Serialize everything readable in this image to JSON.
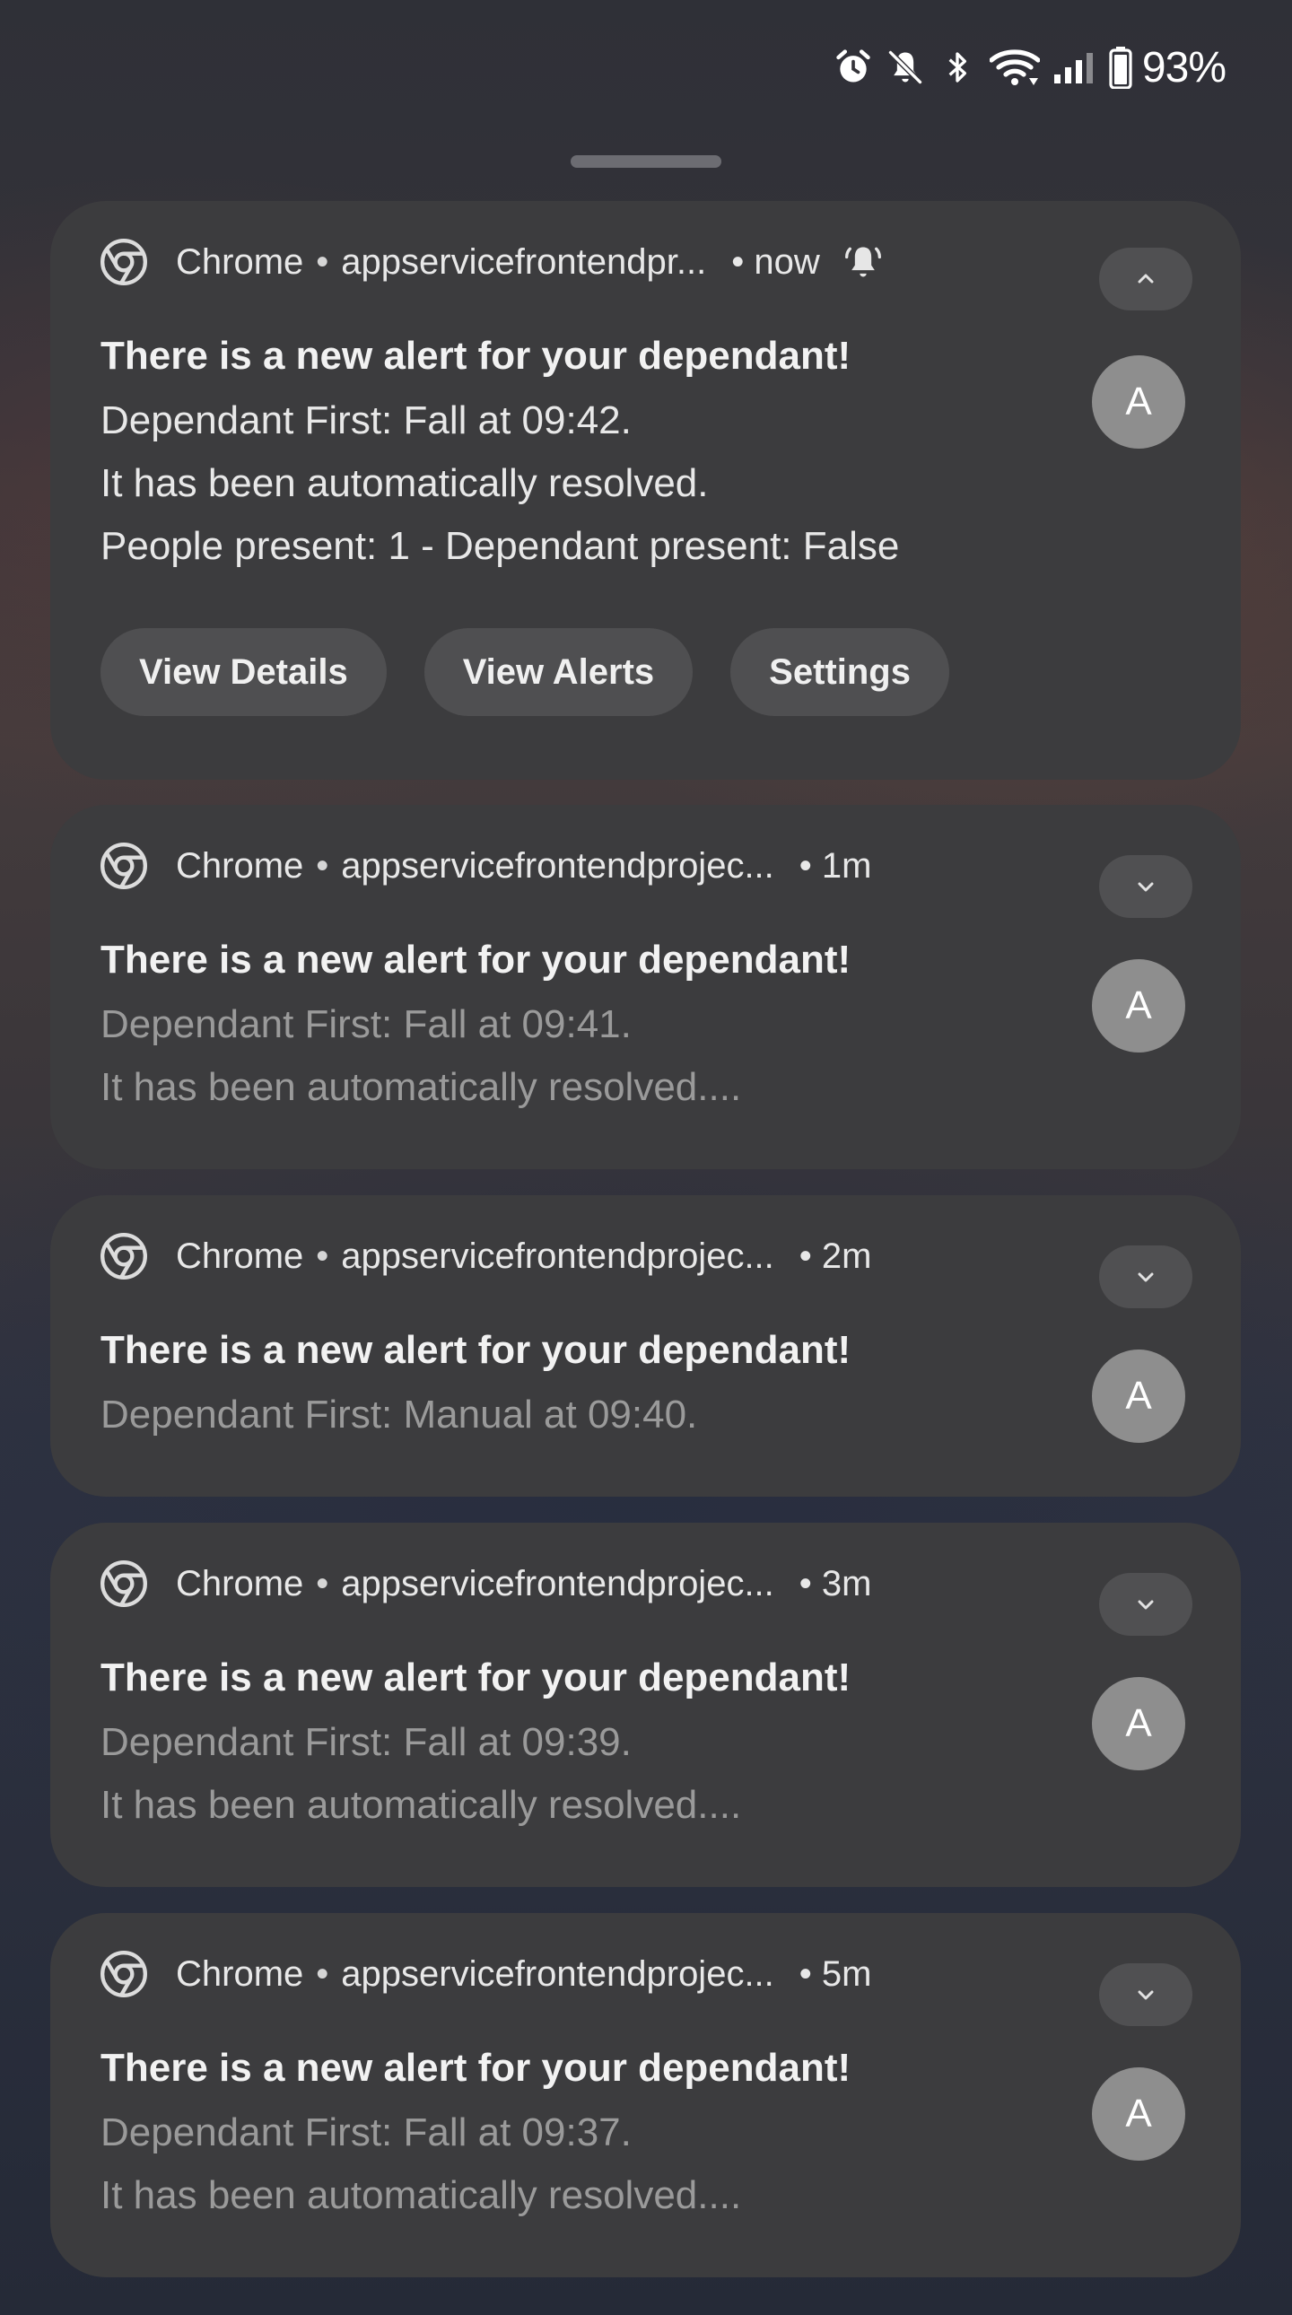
{
  "status_bar": {
    "icons": [
      "alarm-icon",
      "bell-muted-icon",
      "bluetooth-icon",
      "wifi-icon",
      "signal-icon",
      "battery-icon"
    ],
    "battery": "93%"
  },
  "notifications": [
    {
      "app": "Chrome",
      "sep": "•",
      "source": "appservicefrontendpr...",
      "time": "• now",
      "expanded": true,
      "title": "There is a new alert for your dependant!",
      "lines": [
        "Dependant First: Fall at 09:42.",
        "It has been automatically resolved.",
        "People present: 1 - Dependant present: False"
      ],
      "avatar": "A",
      "actions": [
        "View Details",
        "View Alerts",
        "Settings"
      ]
    },
    {
      "app": "Chrome",
      "sep": "•",
      "source": "appservicefrontendprojec...",
      "time": "• 1m",
      "expanded": false,
      "title": "There is a new alert for your dependant!",
      "lines": [
        "Dependant First: Fall at 09:41.",
        "It has been automatically resolved...."
      ],
      "avatar": "A"
    },
    {
      "app": "Chrome",
      "sep": "•",
      "source": "appservicefrontendprojec...",
      "time": "• 2m",
      "expanded": false,
      "title": "There is a new alert for your dependant!",
      "lines": [
        "Dependant First: Manual at 09:40."
      ],
      "avatar": "A"
    },
    {
      "app": "Chrome",
      "sep": "•",
      "source": "appservicefrontendprojec...",
      "time": "• 3m",
      "expanded": false,
      "title": "There is a new alert for your dependant!",
      "lines": [
        "Dependant First: Fall at 09:39.",
        "It has been automatically resolved...."
      ],
      "avatar": "A"
    },
    {
      "app": "Chrome",
      "sep": "•",
      "source": "appservicefrontendprojec...",
      "time": "• 5m",
      "expanded": false,
      "title": "There is a new alert for your dependant!",
      "lines": [
        "Dependant First: Fall at 09:37.",
        "It has been automatically resolved...."
      ],
      "avatar": "A"
    }
  ]
}
